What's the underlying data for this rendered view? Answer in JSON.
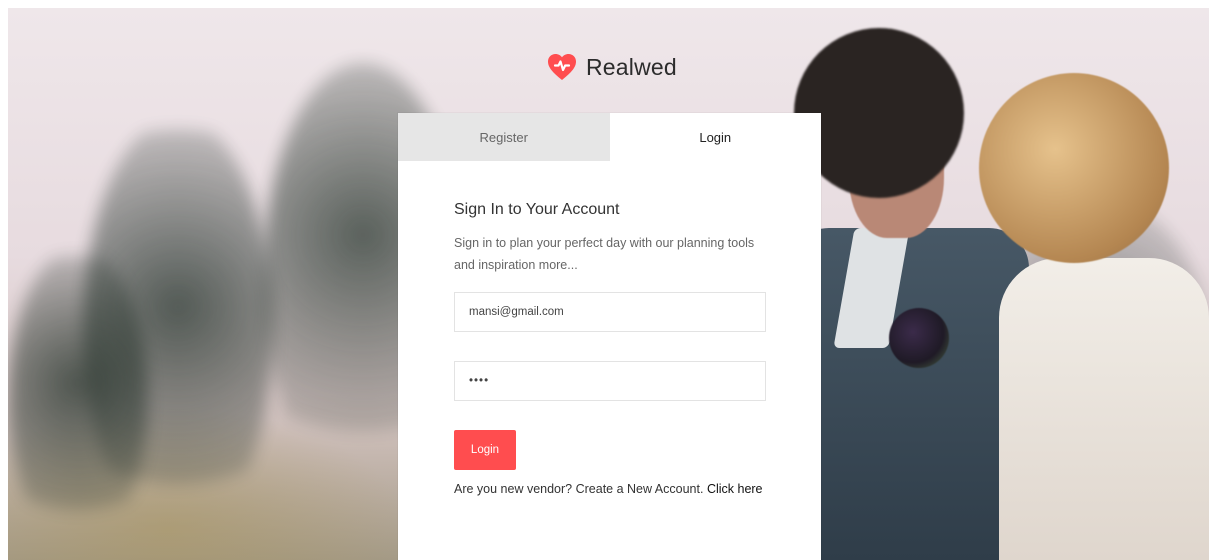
{
  "brand": {
    "name": "Realwed",
    "logo_icon": "heart-logo-icon",
    "accent_color": "#ff4d4f"
  },
  "tabs": [
    {
      "label": "Register",
      "active": false
    },
    {
      "label": "Login",
      "active": true
    }
  ],
  "login_form": {
    "title": "Sign In to Your Account",
    "description": "Sign in to plan your perfect day with our planning tools and inspiration more...",
    "email_value": "mansi@gmail.com",
    "password_value": "••••",
    "submit_label": "Login",
    "footer_text": "Are you new vendor? Create a New Account.",
    "footer_link_label": "Click here"
  }
}
